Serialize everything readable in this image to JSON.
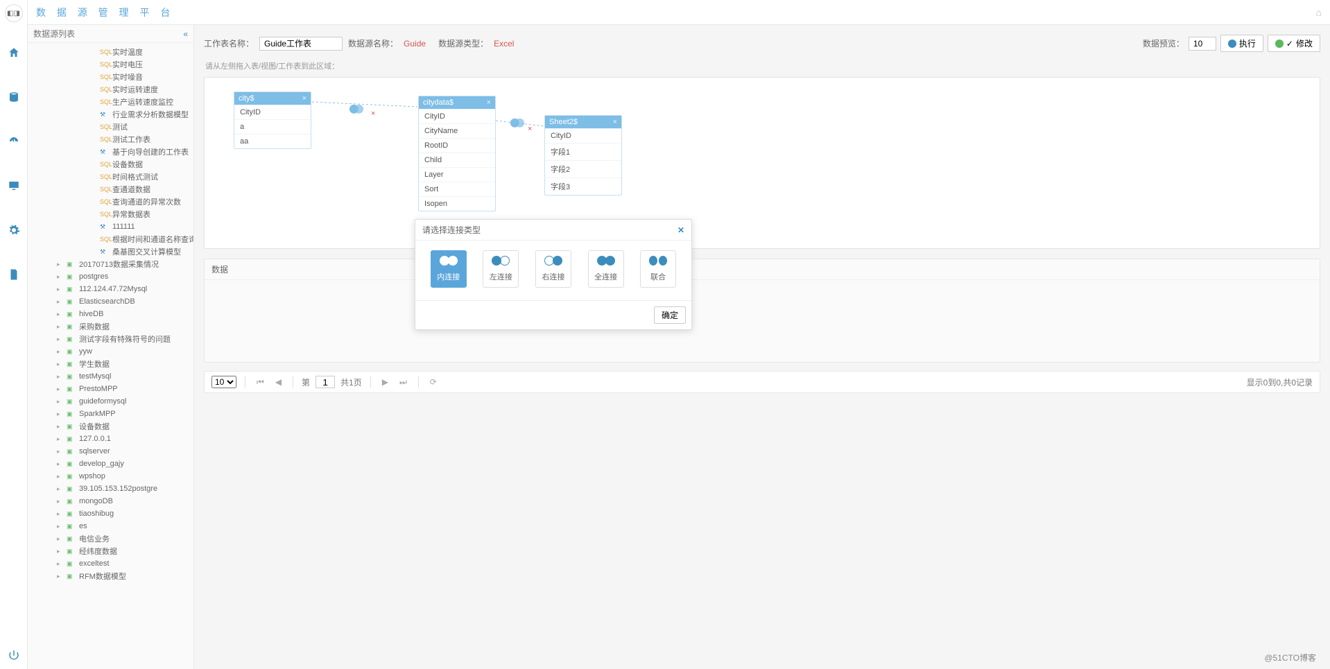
{
  "app_title": "数 据 源 管 理 平 台",
  "sidebar": {
    "title": "数据源列表",
    "collapse": "«",
    "sql_items": [
      "实时温度",
      "实时电压",
      "实时噪音",
      "实时运转速度",
      "生产运转速度监控"
    ],
    "model_item_1": "行业需求分析数据模型",
    "sql_items_2": [
      "测试",
      "测试工作表"
    ],
    "model_item_2": "基于向导创建的工作表",
    "sql_items_3": [
      "设备数据",
      "时间格式测试",
      "查通道数据",
      "查询通道的异常次数",
      "异常数据表"
    ],
    "model_item_3": "111111",
    "sql_items_4": [
      "根据时间和通道名称查询数据明细"
    ],
    "model_item_4": "桑基图交叉计算模型",
    "folders": [
      "20170713数据采集情况",
      "postgres",
      "112.124.47.72Mysql",
      "ElasticsearchDB",
      "hiveDB",
      "采购数据",
      "测试字段有特殊符号的问题",
      "yyw",
      "学生数据",
      "testMysql",
      "PrestoMPP",
      "guideformysql",
      "SparkMPP",
      "设备数据",
      "127.0.0.1",
      "sqlserver",
      "develop_gajy",
      "wpshop",
      "39.105.153.152postgre",
      "mongoDB",
      "tiaoshibug",
      "es",
      "电信业务",
      "经纬度数据",
      "exceltest",
      "RFM数据模型"
    ]
  },
  "toolbar": {
    "ws_label": "工作表名称：",
    "ws_value": "Guide工作表",
    "ds_label": "数据源名称：",
    "ds_value": "Guide",
    "type_label": "数据源类型：",
    "type_value": "Excel",
    "preview_label": "数据预览：",
    "preview_value": "10",
    "run": "执行",
    "modify": "修改"
  },
  "hint": "请从左侧拖入表/视图/工作表到此区域：",
  "tables": {
    "t1": {
      "name": "city$",
      "fields": [
        "CityID",
        "a",
        "aa"
      ]
    },
    "t2": {
      "name": "citydata$",
      "fields": [
        "CityID",
        "CityName",
        "RootID",
        "Child",
        "Layer",
        "Sort",
        "Isopen"
      ]
    },
    "t3": {
      "name": "Sheet2$",
      "fields": [
        "CityID",
        "字段1",
        "字段2",
        "字段3"
      ]
    }
  },
  "data_section": "数据",
  "pager": {
    "size": "10",
    "page_prefix": "第",
    "page": "1",
    "total_pages": "共1页",
    "summary": "显示0到0,共0记录"
  },
  "modal": {
    "title": "请选择连接类型",
    "opts": [
      "内连接",
      "左连接",
      "右连接",
      "全连接",
      "联合"
    ],
    "ok": "确定"
  },
  "watermark": "@51CTO博客"
}
